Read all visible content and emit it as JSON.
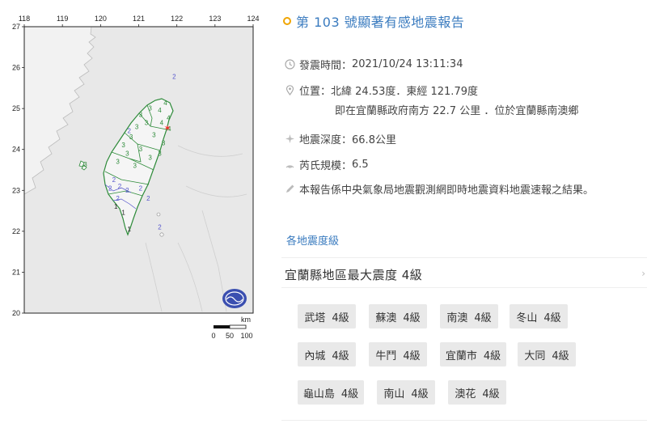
{
  "map": {
    "lon_ticks": [
      "118",
      "119",
      "120",
      "121",
      "122",
      "123",
      "124"
    ],
    "lat_ticks": [
      "27",
      "26",
      "25",
      "24",
      "23",
      "22",
      "21",
      "20"
    ],
    "scale_unit": "km",
    "scale_ticks": [
      "0",
      "50",
      "100"
    ],
    "land_color": "#f2f2f2",
    "sea_color": "#e8e8e8",
    "intensity_green": "#2e8b3a",
    "intensity_blue": "#5555cc",
    "epicenter_color": "#ff2a2a",
    "epicenter_icon": "star-icon",
    "logo_icon": "cwb-logo-icon",
    "intensity_marks": [
      {
        "t": "2",
        "c": "b",
        "lon": 121.93,
        "lat": 25.72
      },
      {
        "t": "4",
        "c": "g",
        "lon": 121.7,
        "lat": 25.08
      },
      {
        "t": "4",
        "c": "g",
        "lon": 121.55,
        "lat": 24.9
      },
      {
        "t": "4",
        "c": "g",
        "lon": 121.78,
        "lat": 24.72
      },
      {
        "t": "4",
        "c": "g",
        "lon": 121.6,
        "lat": 24.6
      },
      {
        "t": "4",
        "c": "g",
        "lon": 121.8,
        "lat": 24.45
      },
      {
        "t": "3",
        "c": "g",
        "lon": 121.3,
        "lat": 24.95
      },
      {
        "t": "3",
        "c": "g",
        "lon": 121.05,
        "lat": 24.8
      },
      {
        "t": "3",
        "c": "g",
        "lon": 121.2,
        "lat": 24.6
      },
      {
        "t": "3",
        "c": "g",
        "lon": 120.95,
        "lat": 24.5
      },
      {
        "t": "3",
        "c": "g",
        "lon": 121.4,
        "lat": 24.3
      },
      {
        "t": "3",
        "c": "g",
        "lon": 120.8,
        "lat": 24.25
      },
      {
        "t": "3",
        "c": "g",
        "lon": 121.65,
        "lat": 24.1
      },
      {
        "t": "3",
        "c": "g",
        "lon": 121.55,
        "lat": 23.85
      },
      {
        "t": "3",
        "c": "g",
        "lon": 120.6,
        "lat": 24.05
      },
      {
        "t": "3",
        "c": "g",
        "lon": 120.7,
        "lat": 23.85
      },
      {
        "t": "3",
        "c": "g",
        "lon": 121.05,
        "lat": 23.95
      },
      {
        "t": "3",
        "c": "g",
        "lon": 121.3,
        "lat": 23.75
      },
      {
        "t": "3",
        "c": "g",
        "lon": 120.45,
        "lat": 23.65
      },
      {
        "t": "3",
        "c": "g",
        "lon": 120.9,
        "lat": 23.55
      },
      {
        "t": "2",
        "c": "b",
        "lon": 120.75,
        "lat": 24.4
      },
      {
        "t": "2",
        "c": "b",
        "lon": 120.35,
        "lat": 23.2
      },
      {
        "t": "2",
        "c": "b",
        "lon": 120.25,
        "lat": 23.0
      },
      {
        "t": "2",
        "c": "b",
        "lon": 120.5,
        "lat": 23.05
      },
      {
        "t": "2",
        "c": "b",
        "lon": 120.7,
        "lat": 22.95
      },
      {
        "t": "2",
        "c": "b",
        "lon": 121.05,
        "lat": 23.0
      },
      {
        "t": "2",
        "c": "b",
        "lon": 120.45,
        "lat": 22.75
      },
      {
        "t": "2",
        "c": "b",
        "lon": 121.25,
        "lat": 22.75
      },
      {
        "t": "2",
        "c": "b",
        "lon": 121.55,
        "lat": 22.05
      },
      {
        "t": "1",
        "c": "k",
        "lon": 120.4,
        "lat": 22.55
      },
      {
        "t": "1",
        "c": "k",
        "lon": 120.6,
        "lat": 22.4
      },
      {
        "t": "1",
        "c": "k",
        "lon": 120.75,
        "lat": 22.0
      },
      {
        "t": "3",
        "c": "g",
        "lon": 119.6,
        "lat": 23.58
      }
    ]
  },
  "report": {
    "title": "第 103 號顯著有感地震報告",
    "time_label": "發震時間：",
    "time_value": "2021/10/24 13:11:34",
    "loc_label": "位置：",
    "loc_value": "北緯 24.53度．東經 121.79度",
    "loc_detail": "即在宜蘭縣政府南方 22.7 公里 ．位於宜蘭縣南澳鄉",
    "depth_label": "地震深度：",
    "depth_value": "66.8公里",
    "mag_label": "芮氏規模：",
    "mag_value": "6.5",
    "note": "本報告係中央氣象局地震觀測網即時地震資料地震速報之結果。",
    "section_title": "各地震度級",
    "region_heading": "宜蘭縣地區最大震度 4級",
    "stations": [
      {
        "name": "武塔",
        "level": "4級"
      },
      {
        "name": "蘇澳",
        "level": "4級"
      },
      {
        "name": "南澳",
        "level": "4級"
      },
      {
        "name": "冬山",
        "level": "4級"
      },
      {
        "name": "內城",
        "level": "4級"
      },
      {
        "name": "牛鬥",
        "level": "4級"
      },
      {
        "name": "宜蘭市",
        "level": "4級"
      },
      {
        "name": "大同",
        "level": "4級"
      },
      {
        "name": "龜山島",
        "level": "4級"
      },
      {
        "name": "南山",
        "level": "4級"
      },
      {
        "name": "澳花",
        "level": "4級"
      }
    ],
    "accent_color": "#3a7bbf",
    "dot_color": "#f0a500"
  }
}
